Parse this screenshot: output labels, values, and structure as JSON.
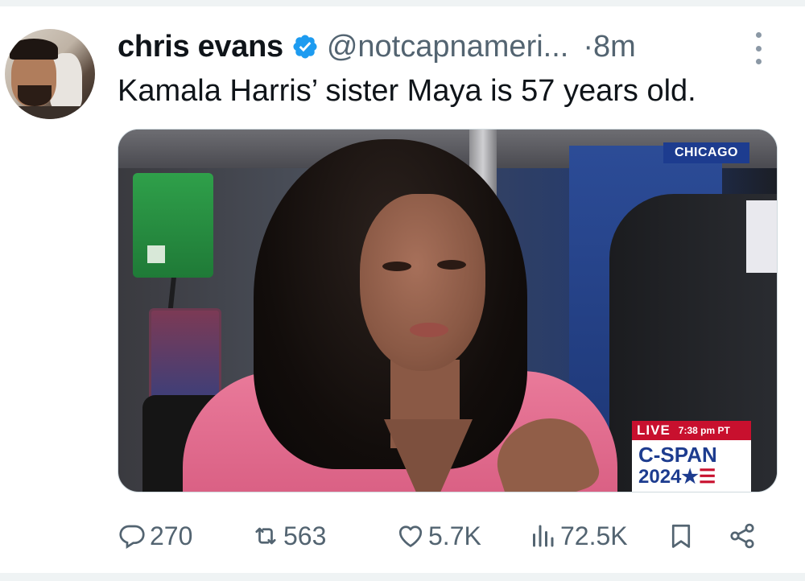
{
  "tweet": {
    "author": {
      "display_name": "chris evans",
      "handle": "@notcapnameri...",
      "verified": true
    },
    "time_separator": "·",
    "time": "8m",
    "text": "Kamala Harris’ sister Maya is 57 years old.",
    "media": {
      "location_tag": "CHICAGO",
      "live_label": "LIVE",
      "live_time": "7:38 pm PT",
      "network": "C-SPAN",
      "network_year": "2024",
      "network_year_star": "★",
      "network_year_stripes": "☰"
    },
    "metrics": {
      "replies": "270",
      "retweets": "563",
      "likes": "5.7K",
      "views": "72.5K"
    }
  },
  "colors": {
    "verified_badge": "#1d9bf0",
    "secondary_text": "#536471",
    "cspan_blue": "#1d3c8f",
    "live_red": "#c8102e",
    "jacket_pink": "#e97a9a"
  },
  "icons": {
    "reply": "speech-bubble-icon",
    "retweet": "retweet-arrows-icon",
    "like": "heart-outline-icon",
    "views": "bar-chart-icon",
    "bookmark": "bookmark-icon",
    "share": "share-nodes-icon",
    "more": "vertical-dots-icon"
  }
}
